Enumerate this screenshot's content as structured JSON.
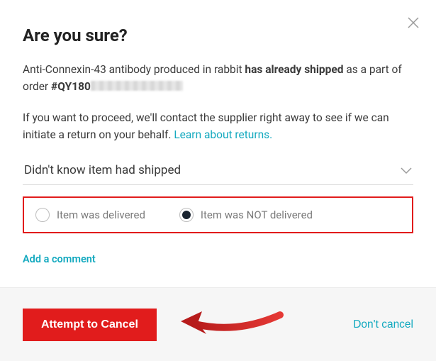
{
  "dialog": {
    "title": "Are you sure?",
    "line1_pre": "Anti-Connexin-43 antibody produced in rabbit ",
    "line1_bold": "has already shipped",
    "line1_post": " as a part of order ",
    "order_prefix": "#QY180",
    "line2": "If you want to proceed, we'll contact the supplier right away to see if we can initiate a return on your behalf. ",
    "learn_link": "Learn about returns.",
    "select_value": "Didn't know item had shipped",
    "radios": {
      "opt1": "Item was delivered",
      "opt2": "Item was NOT delivered"
    },
    "add_comment": "Add a comment"
  },
  "footer": {
    "primary": "Attempt to Cancel",
    "secondary": "Don't cancel"
  }
}
